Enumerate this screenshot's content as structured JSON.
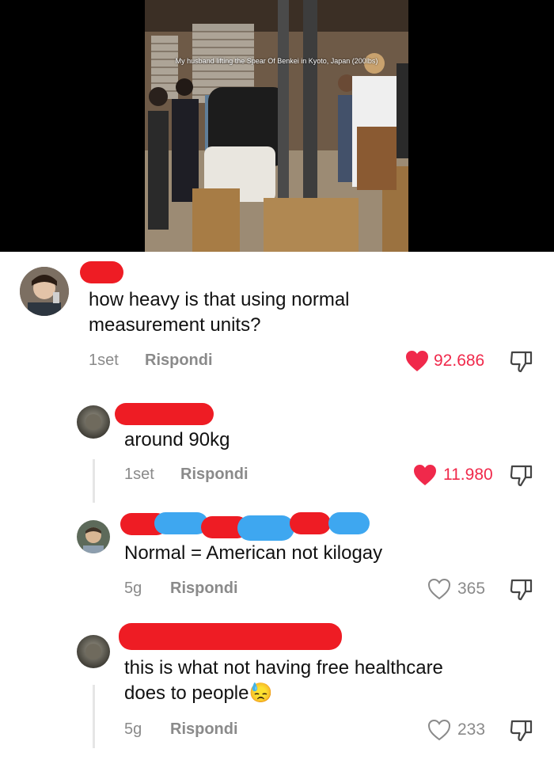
{
  "video": {
    "caption": "My husband lifting the Spear Of Benkei in Kyoto, Japan (200lbs)"
  },
  "comments": [
    {
      "text_lines": [
        "how heavy is that using normal",
        "measurement units?"
      ],
      "time": "1set",
      "reply": "Rispondi",
      "likes": "92.686",
      "liked": true
    },
    {
      "text_lines": [
        "around 90kg"
      ],
      "time": "1set",
      "reply": "Rispondi",
      "likes": "11.980",
      "liked": true
    },
    {
      "text_lines": [
        "Normal = American not kilogay"
      ],
      "time": "5g",
      "reply": "Rispondi",
      "likes": "365",
      "liked": false
    },
    {
      "text_lines": [
        "this is what not having free healthcare",
        "does to people"
      ],
      "emoji": "😓",
      "time": "5g",
      "reply": "Rispondi",
      "likes": "233",
      "liked": false
    }
  ],
  "colors": {
    "heart_liked": "#f0294b",
    "redact_red": "#ee1c24",
    "redact_blue": "#3ea7f0",
    "meta_gray": "#8a8a8a"
  },
  "icons": [
    "heart-icon",
    "dislike-icon",
    "avatar"
  ]
}
